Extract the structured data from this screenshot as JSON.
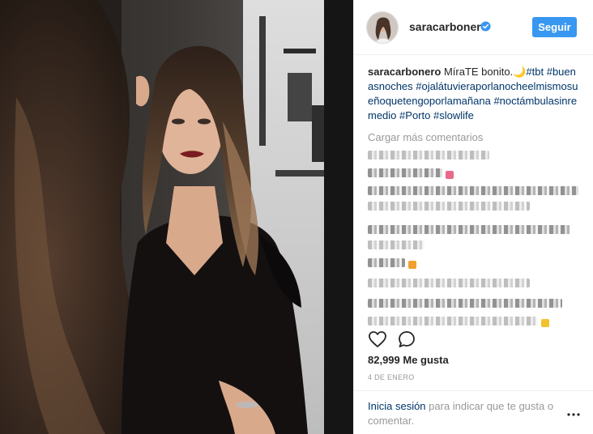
{
  "post": {
    "username": "saracarbonero",
    "follow_label": "Seguir",
    "caption_text": "MíraTE bonito.",
    "caption_moon": "🌙",
    "hashtags": [
      "#tbt",
      "#buenasnoches",
      "#ojalátuvieraporlanocheelmismosueñoquetengoporlamañana",
      "#noctámbulasinremedio",
      "#Porto",
      "#slowlife"
    ],
    "load_more_label": "Cargar más comentarios",
    "likes_text": "82,999 Me gusta",
    "date_text": "4 DE ENERO",
    "login_link": "Inicia sesión",
    "login_rest": " para indicar que te gusta o comentar."
  },
  "icons": {
    "verified": "verified-badge-icon",
    "like": "heart-icon",
    "comment": "comment-bubble-icon",
    "more": "more-options-icon"
  },
  "colors": {
    "accent": "#3897f0",
    "link": "#003569",
    "muted": "#999999",
    "text": "#262626"
  }
}
